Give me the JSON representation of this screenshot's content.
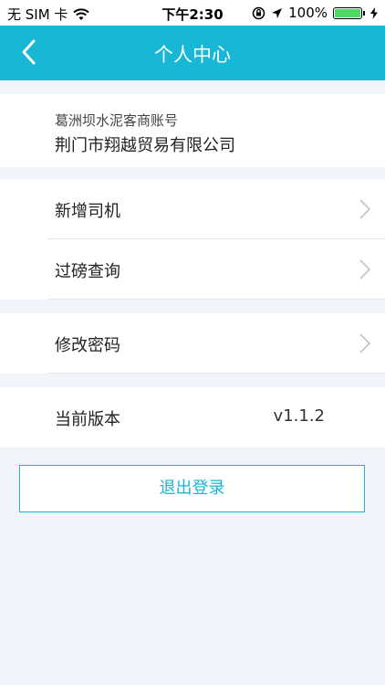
{
  "status_bar": {
    "carrier": "无 SIM 卡",
    "time": "下午2:30",
    "battery": "100%"
  },
  "nav": {
    "title": "个人中心"
  },
  "account": {
    "label": "葛洲坝水泥客商账号",
    "name": "荆门市翔越贸易有限公司"
  },
  "menu": {
    "add_driver": "新增司机",
    "weigh_query": "过磅查询",
    "change_password": "修改密码"
  },
  "version": {
    "label": "当前版本",
    "value": "v1.1.2"
  },
  "logout": {
    "label": "退出登录"
  },
  "colors": {
    "accent": "#17b7d5",
    "background": "#f1f4f9"
  }
}
